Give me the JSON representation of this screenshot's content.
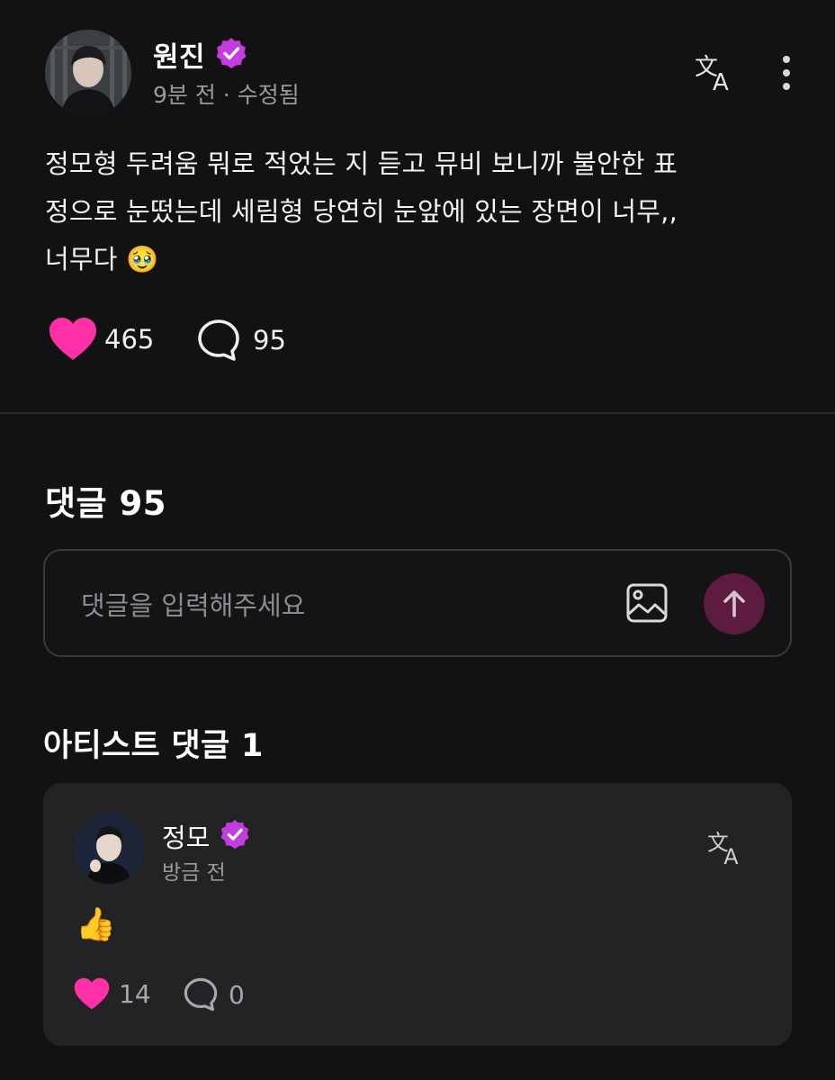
{
  "post": {
    "author_name": "원진",
    "meta": "9분 전 · 수정됨",
    "body_lines": [
      "정모형 두려움 뭐로 적었는 지 듣고 뮤비 보니까 불안한 표",
      "정으로 눈떴는데 세림형 당연히 눈앞에 있는 장면이 너무,,",
      "너무다 🥹"
    ],
    "likes": "465",
    "comments": "95"
  },
  "comments_section": {
    "title": "댓글 95",
    "input_placeholder": "댓글을 입력해주세요"
  },
  "artist_comments": {
    "title": "아티스트 댓글 1",
    "items": [
      {
        "author_name": "정모",
        "time": "방금 전",
        "body": "👍",
        "likes": "14",
        "replies": "0"
      }
    ]
  },
  "icons": {
    "verified_badge": "verified-badge-icon",
    "translate": "translate-icon",
    "more": "more-vertical-icon",
    "heart": "heart-icon",
    "comment": "comment-bubble-icon",
    "image": "image-attach-icon",
    "send": "arrow-up-icon"
  },
  "colors": {
    "background": "#121113",
    "accent_pink": "#ff2fa6",
    "badge_magenta": "#c43be0",
    "send_button": "#5c1b3f",
    "card": "#232225"
  }
}
